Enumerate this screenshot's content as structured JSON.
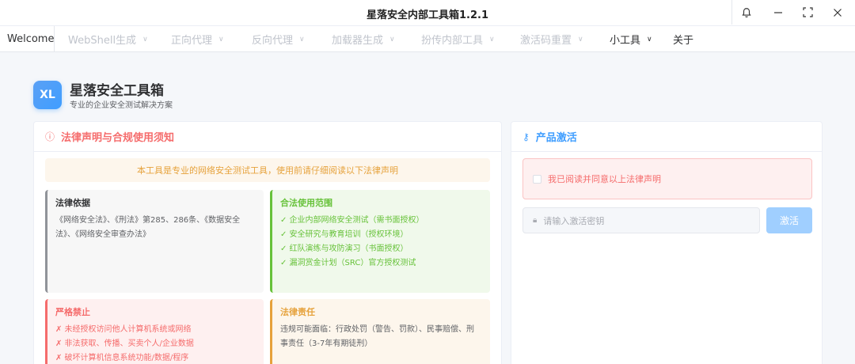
{
  "window": {
    "title": "星落安全内部工具箱1.2.1",
    "bell_icon": "bell-icon",
    "minimize_icon": "minimize-icon",
    "maximize_icon": "maximize-icon",
    "close_icon": "close-icon"
  },
  "menu": {
    "welcome": "Welcome",
    "items": [
      {
        "label": "WebShell生成"
      },
      {
        "label": "正向代理"
      },
      {
        "label": "反向代理"
      },
      {
        "label": "加载器生成"
      },
      {
        "label": "扮传内部工具"
      },
      {
        "label": "激活码重置"
      },
      {
        "label": "小工具"
      }
    ],
    "about": "关于"
  },
  "brand": {
    "logo_text": "XL",
    "title": "星落安全工具箱",
    "subtitle": "专业的企业安全测试解决方案"
  },
  "legal": {
    "title": "法律声明与合规使用须知",
    "notice": "本工具是专业的网络安全测试工具，使用前请仔细阅读以下法律声明",
    "basis": {
      "title": "法律依据",
      "lines": [
        "《网络安全法》、《刑法》第285、286条、《数据安全",
        "法》、《网络安全审查办法》"
      ]
    },
    "scope": {
      "title": "合法使用范围",
      "lines": [
        "✓ 企业内部网络安全测试（需书面授权）",
        "✓ 安全研究与教育培训（授权环境）",
        "✓ 红队演练与攻防演习（书面授权）",
        "✓ 漏洞赏金计划（SRC）官方授权测试"
      ]
    },
    "forbid": {
      "title": "严格禁止",
      "lines": [
        "✗ 未经授权访问他人计算机系统或网络",
        "✗ 非法获取、传播、买卖个人/企业数据",
        "✗ 破坏计算机信息系统功能/数据/程序"
      ]
    },
    "resp": {
      "title": "法律责任",
      "lines": [
        "违规可能面临：行政处罚（警告、罚款）、民事赔偿、刑",
        "事责任（3-7年有期徒刑）"
      ]
    }
  },
  "activation": {
    "title": "产品激活",
    "agree_label": "我已阅读并同意以上法律声明",
    "key_placeholder": "请输入激活密钥",
    "activate_label": "激活"
  }
}
